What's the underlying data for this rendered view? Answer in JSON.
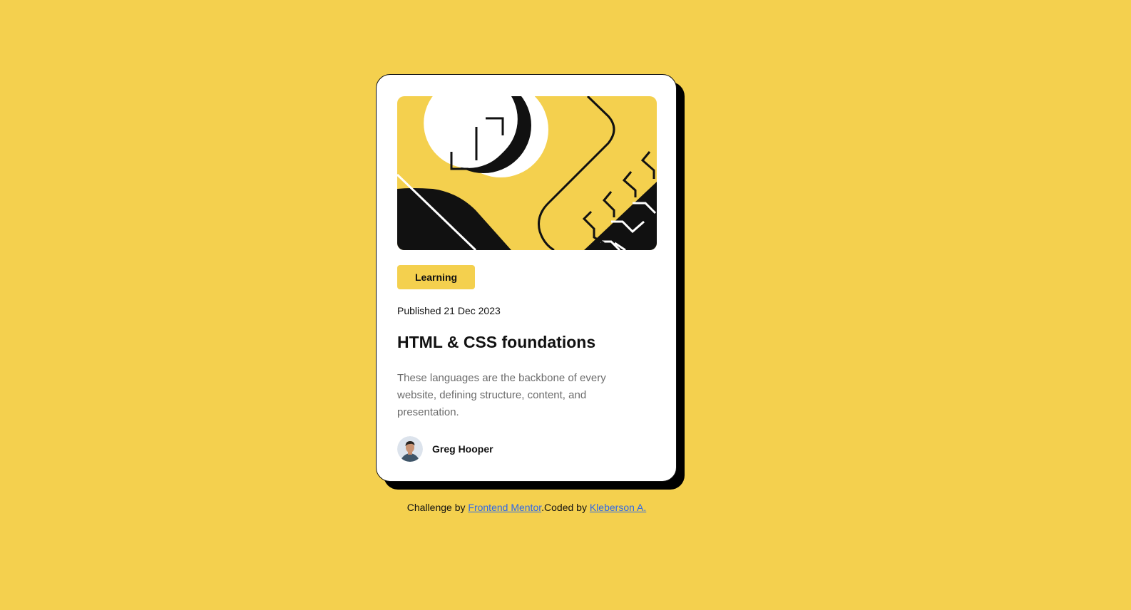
{
  "colors": {
    "background": "#F4D04E",
    "card": "#FFFFFF",
    "ink": "#111111",
    "muted_text": "#6B6B6B",
    "link": "#2D68E8"
  },
  "card": {
    "illustration_icon": "abstract-illustration",
    "tag": "Learning",
    "published": "Published 21 Dec 2023",
    "title": "HTML & CSS foundations",
    "description": "These languages are the backbone of every website, defining structure, content, and presentation.",
    "author": {
      "avatar_icon": "author-avatar",
      "name": "Greg Hooper"
    }
  },
  "attribution": {
    "prefix": "Challenge by ",
    "link1": "Frontend Mentor",
    "middle": ".Coded by ",
    "link2": "Kleberson A."
  }
}
